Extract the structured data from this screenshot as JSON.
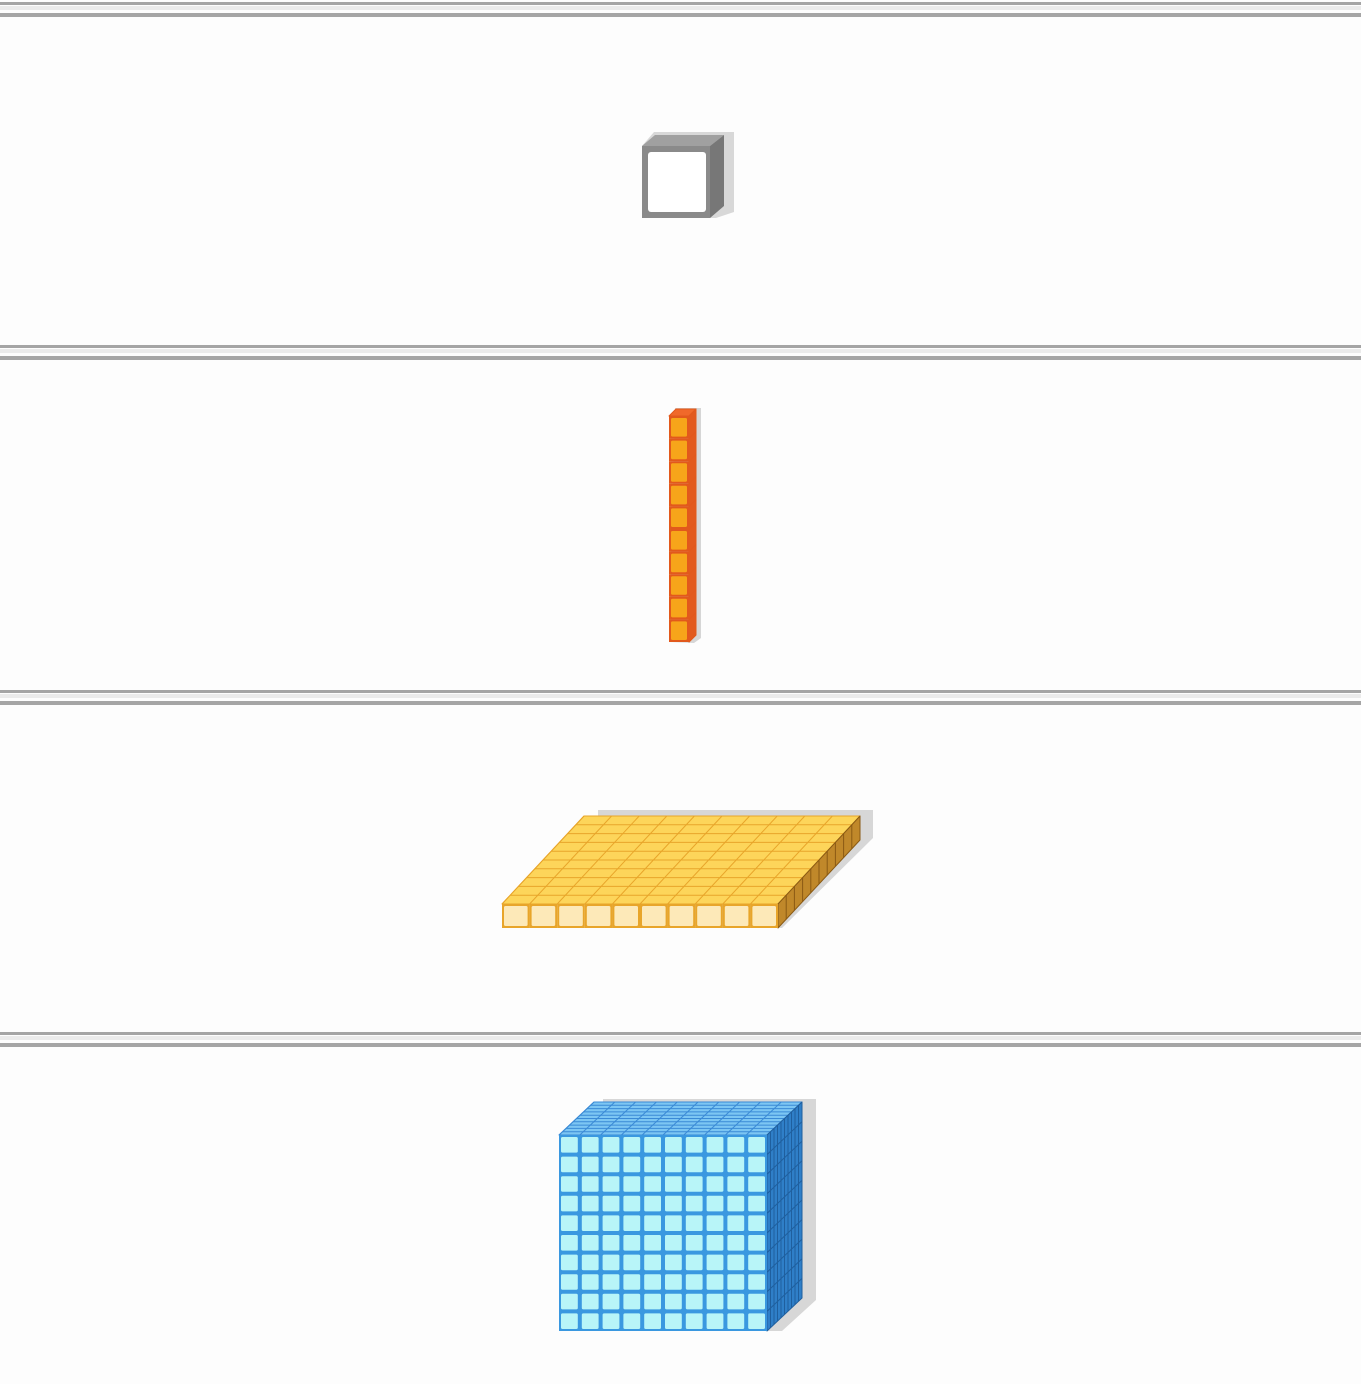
{
  "blocks": [
    {
      "kind": "unit",
      "cubes": 1,
      "face": "#ffffff",
      "edge": "#8a8a8a",
      "side": "#777777",
      "top": "#a0a0a0"
    },
    {
      "kind": "rod",
      "cubes": 10,
      "face": "#f7a51a",
      "edge": "#e2591c",
      "side": "#e25a1e",
      "top": "#f0692a"
    },
    {
      "kind": "flat",
      "cubes": 100,
      "face": "#fde9b8",
      "edge": "#e8a52a",
      "side": "#c0882a",
      "top": "#fdd55a"
    },
    {
      "kind": "cube",
      "cubes": 1000,
      "face": "#b8f5f8",
      "edge": "#3a98e0",
      "side": "#2f7fc8",
      "top": "#7cc6f3"
    }
  ]
}
